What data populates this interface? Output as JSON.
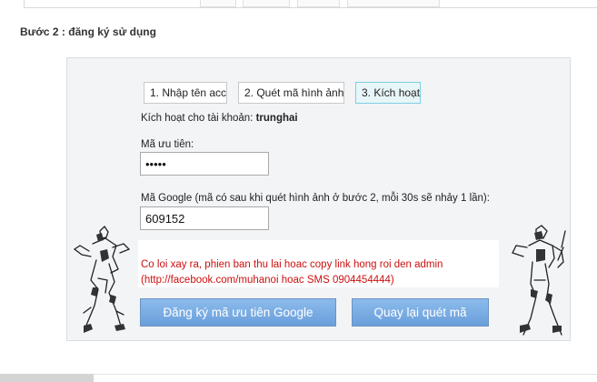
{
  "step_heading": "Bước 2 : đăng ký sử dụng",
  "tabs": [
    {
      "label": "1. Nhập tên acc",
      "active": false
    },
    {
      "label": "2. Quét mã hình ảnh",
      "active": false
    },
    {
      "label": "3. Kích hoạt",
      "active": true
    }
  ],
  "account": {
    "prefix": "Kích hoạt cho tài khoản:",
    "username": "trunghai"
  },
  "priority_code": {
    "label": "Mã ưu tiên:",
    "value": "•••••"
  },
  "google_code": {
    "label": "Mã Google (mã có sau khi quét hình ảnh ở bước 2, mỗi 30s sẽ nhảy 1 lần):",
    "value": "609152"
  },
  "error": {
    "line1": "Co loi xay ra, phien ban thu lai hoac copy link hong roi den admin",
    "line2": "(http://facebook.com/muhanoi hoac SMS 0904454444)"
  },
  "buttons": {
    "register": "Đăng ký mã ưu tiên Google",
    "back": "Quay lại quét mã"
  },
  "colors": {
    "button": "#7aaee4",
    "error_text": "#cc1010",
    "active_tab": "#7ccfe0"
  }
}
